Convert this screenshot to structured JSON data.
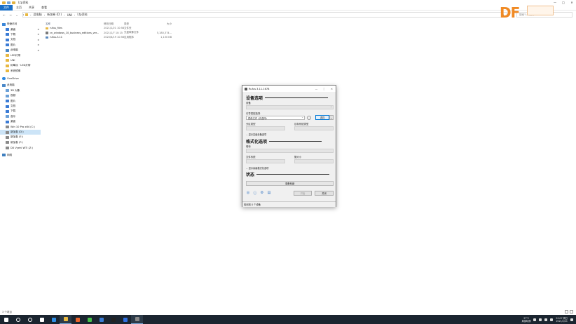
{
  "window": {
    "title": "Ltp资料",
    "controls": [
      "—",
      "□",
      "✕"
    ]
  },
  "ribbon": {
    "tabs": [
      "文件",
      "主页",
      "共享",
      "查看"
    ]
  },
  "address": {
    "crumbs": [
      "此电脑",
      "新加卷 (D:)",
      "UNI",
      "Ltp资料"
    ],
    "search_placeholder": "搜索“Ltp资料”"
  },
  "logo": {
    "text": "DF"
  },
  "sidebar": {
    "items": [
      {
        "label": "快速访问",
        "icon": "star-icon",
        "level": 1,
        "pinned": false
      },
      {
        "label": "桌面",
        "icon": "desktop-icon",
        "level": 2,
        "pinned": true
      },
      {
        "label": "下载",
        "icon": "download-icon",
        "level": 2,
        "pinned": true
      },
      {
        "label": "文档",
        "icon": "document-icon",
        "level": 2,
        "pinned": true
      },
      {
        "label": "图片",
        "icon": "pictures-icon",
        "level": 2,
        "pinned": true
      },
      {
        "label": "此电脑",
        "icon": "computer-icon",
        "level": 2,
        "pinned": true
      },
      {
        "label": "LED灯带",
        "icon": "folder-icon",
        "level": 2,
        "pinned": false
      },
      {
        "label": "UNI",
        "icon": "folder-icon",
        "level": 2,
        "pinned": false
      },
      {
        "label": "树莓派 · LED灯带",
        "icon": "folder-icon",
        "level": 2,
        "pinned": false
      },
      {
        "label": "系统镜像",
        "icon": "folder-icon",
        "level": 2,
        "pinned": false
      },
      {
        "label": "OneDrive",
        "icon": "cloud-icon",
        "level": 1,
        "pinned": false,
        "gap_before": true
      },
      {
        "label": "此电脑",
        "icon": "computer-icon",
        "level": 1,
        "pinned": false,
        "gap_before": true
      },
      {
        "label": "3D 对象",
        "icon": "cube-icon",
        "level": 2,
        "pinned": false
      },
      {
        "label": "视频",
        "icon": "video-icon",
        "level": 2,
        "pinned": false
      },
      {
        "label": "图片",
        "icon": "pictures-icon",
        "level": 2,
        "pinned": false
      },
      {
        "label": "文档",
        "icon": "document-icon",
        "level": 2,
        "pinned": false
      },
      {
        "label": "下载",
        "icon": "download-icon",
        "level": 2,
        "pinned": false
      },
      {
        "label": "音乐",
        "icon": "music-icon",
        "level": 2,
        "pinned": false
      },
      {
        "label": "桌面",
        "icon": "desktop-icon",
        "level": 2,
        "pinned": false
      },
      {
        "label": "Win 10 Pro x64 (C:)",
        "icon": "drive-icon",
        "level": 2,
        "pinned": false
      },
      {
        "label": "新加卷 (D:)",
        "icon": "drive-icon",
        "level": 2,
        "pinned": false,
        "selected": true
      },
      {
        "label": "新加卷 (E:)",
        "icon": "drive-icon",
        "level": 2,
        "pinned": false
      },
      {
        "label": "新加卷 (F:)",
        "icon": "drive-icon",
        "level": 2,
        "pinned": false
      },
      {
        "label": "DX Vyehi WTI (Z:)",
        "icon": "drive-icon",
        "level": 2,
        "pinned": false
      },
      {
        "label": "网络",
        "icon": "network-icon",
        "level": 1,
        "pinned": false,
        "gap_before": true
      }
    ]
  },
  "filelist": {
    "headers": [
      "名称",
      "修改日期",
      "类型",
      "大小"
    ],
    "rows": [
      {
        "name": "rufus_files",
        "date": "2021/2/21 10:58",
        "type": "文件夹",
        "size": "",
        "icon": "folder-icon"
      },
      {
        "name": "cn_windows_10_business_editions_ver...",
        "date": "2021/2/7 10:15",
        "type": "光盘映像文件",
        "size": "5,180,374...",
        "icon": "disc-image-icon"
      },
      {
        "name": "rufus-3.11",
        "date": "2020/6/19 10:56",
        "type": "应用程序",
        "size": "1,130 KB",
        "icon": "app-icon"
      }
    ]
  },
  "statusbar": {
    "text": "3 个项目"
  },
  "rufus": {
    "title": "Rufus 3.11.1678",
    "sec_drive": "设备选项",
    "lbl_device": "设备",
    "lbl_boot": "引导类型选择",
    "boot_value": "镜像文件 (请选择)",
    "btn_select": "选择",
    "lbl_partition": "分区类型",
    "lbl_target": "目标系统类型",
    "adv_drive": "显示高级设备选项",
    "sec_format": "格式化选项",
    "lbl_volume": "卷标",
    "lbl_fs": "文件系统",
    "lbl_cluster": "簇大小",
    "adv_format": "显示高级格式化选项",
    "sec_status": "状态",
    "progress_text": "准备就绪",
    "btn_start": "开始",
    "btn_close": "关闭",
    "status_text": "检测到 0 个设备",
    "tools": [
      "globe-icon",
      "info-icon",
      "settings-icon",
      "log-icon"
    ]
  },
  "taskbar": {
    "apps": [
      {
        "icon": "windows-start-icon",
        "color": "#ffffff"
      },
      {
        "icon": "search-icon",
        "color": "#ffffff"
      },
      {
        "icon": "cortana-icon",
        "color": "#ffffff"
      },
      {
        "icon": "task-view-icon",
        "color": "#ffffff"
      },
      {
        "icon": "edge-icon",
        "color": "#2f8de4"
      },
      {
        "icon": "file-explorer-icon",
        "color": "#e8b840",
        "active": true
      },
      {
        "icon": "firefox-icon",
        "color": "#e8632b"
      },
      {
        "icon": "wechat-icon",
        "color": "#46c04a"
      },
      {
        "icon": "mail-icon",
        "color": "#3a7bd5"
      },
      {
        "icon": "qq-icon",
        "color": "#222222"
      },
      {
        "icon": "baidu-icon",
        "color": "#2f6fe0"
      },
      {
        "icon": "rufus-icon",
        "color": "#888888",
        "active": true
      }
    ],
    "weather": {
      "temp": "37°C",
      "desc": "局部晴朗"
    },
    "clock": {
      "time": "20:07 周日",
      "date": "2021/2/21"
    }
  },
  "colors": {
    "accent": "#1a6fc7",
    "logo": "#f08a24",
    "taskbar": "#1b2530"
  }
}
